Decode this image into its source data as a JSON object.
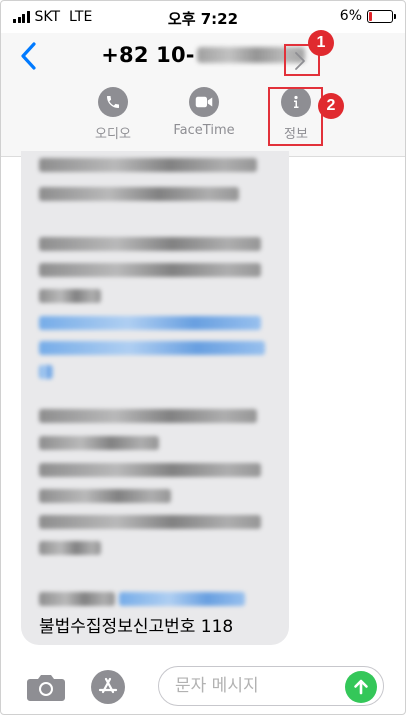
{
  "status_bar": {
    "carrier": "SKT",
    "network": "LTE",
    "time": "오후 7:22",
    "battery": "6%",
    "battery_level_fraction": 0.06,
    "battery_color": "#e0252b"
  },
  "header": {
    "back_icon": "chevron-left-icon",
    "contact_number_visible": "+82 10-",
    "chevron_icon": "chevron-right-icon",
    "actions": [
      {
        "label": "오디오",
        "icon": "phone-icon"
      },
      {
        "label": "FaceTime",
        "icon": "video-camera-icon"
      },
      {
        "label": "정보",
        "icon": "info-icon"
      }
    ]
  },
  "annotations": {
    "badge_1": "1",
    "badge_2": "2",
    "color": "#e2313a"
  },
  "message": {
    "last_line": "불법수집정보신고번호 118"
  },
  "composer": {
    "camera_icon": "camera-icon",
    "appstore_icon": "app-store-icon",
    "placeholder": "문자 메시지",
    "send_icon": "send-arrow-icon",
    "send_color": "#34c759",
    "accent_color": "#007aff"
  }
}
